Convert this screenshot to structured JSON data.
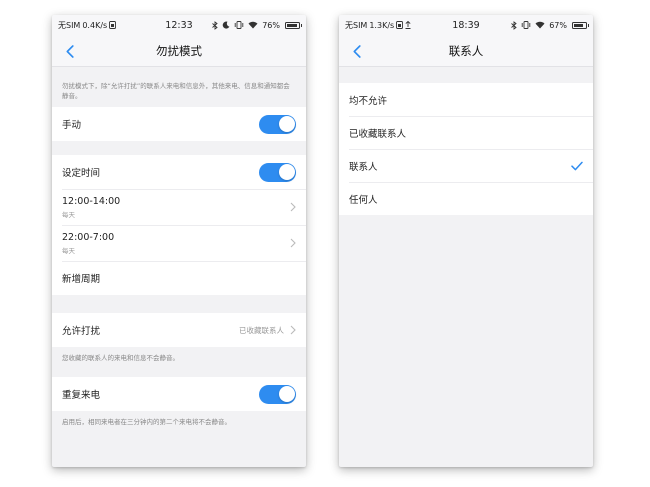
{
  "left": {
    "status": {
      "carrier": "无SIM",
      "speed": "0.4K/s",
      "time": "12:33",
      "battery": "76%",
      "battery_fraction": 0.76
    },
    "nav": {
      "title": "勿扰模式"
    },
    "intro_note": "勿扰模式下，除“允许打扰”的联系人来电和信息外，其他来电、信息和通知都会静音。",
    "manual": {
      "label": "手动",
      "on": true
    },
    "schedule": {
      "label": "设定时间",
      "on": true,
      "periods": [
        {
          "time": "12:00-14:00",
          "repeat": "每天"
        },
        {
          "time": "22:00-7:00",
          "repeat": "每天"
        }
      ],
      "add_label": "新增周期"
    },
    "allow": {
      "label": "允许打扰",
      "value": "已收藏联系人",
      "note": "您收藏的联系人的来电和信息不会静音。"
    },
    "repeat_calls": {
      "label": "重复来电",
      "on": true,
      "note": "启用后，相同来电者在三分钟内的第二个来电将不会静音。"
    }
  },
  "right": {
    "status": {
      "carrier": "无SIM",
      "speed": "1.3K/s",
      "time": "18:39",
      "battery": "67%",
      "battery_fraction": 0.67
    },
    "nav": {
      "title": "联系人"
    },
    "options": [
      {
        "label": "均不允许",
        "selected": false
      },
      {
        "label": "已收藏联系人",
        "selected": false
      },
      {
        "label": "联系人",
        "selected": true
      },
      {
        "label": "任何人",
        "selected": false
      }
    ]
  },
  "colors": {
    "accent": "#2e8cf0",
    "background": "#f2f2f4"
  },
  "icons": {
    "back": "chevron-left-icon",
    "forward": "chevron-right-icon",
    "check": "checkmark-icon",
    "bluetooth": "bluetooth-icon",
    "moon": "moon-icon",
    "vibrate": "vibrate-icon",
    "wifi": "wifi-icon",
    "battery": "battery-icon",
    "upload": "upload-arrow-icon"
  }
}
